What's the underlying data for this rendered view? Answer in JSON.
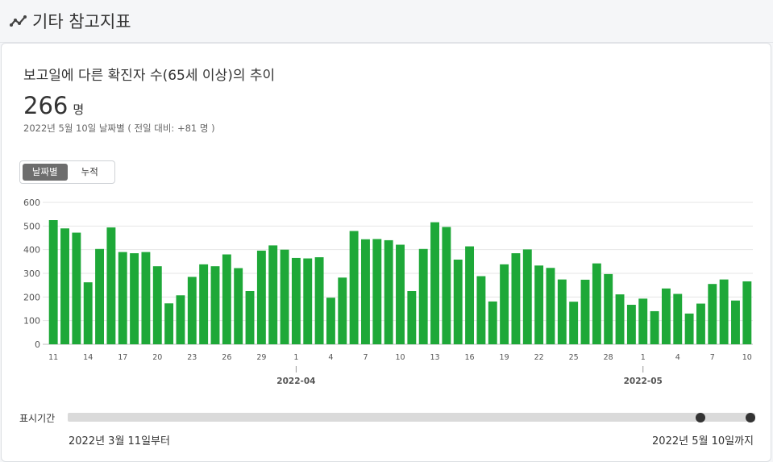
{
  "header": {
    "title": "기타 참고지표",
    "icon": "trend-line-icon"
  },
  "card": {
    "title": "보고일에 다른 확진자 수(65세 이상)의 추이",
    "big_value": "266",
    "big_unit": "명",
    "subtitle": "2022년 5월 10일 날짜별 ( 전일 대비: +81 명 )"
  },
  "toggle": {
    "daily_label": "날짜별",
    "cumulative_label": "누적",
    "selected": "daily"
  },
  "range": {
    "label": "표시기간",
    "start_text": "2022년 3월 11일부터",
    "end_text": "2022년 5월 10일까지"
  },
  "colors": {
    "bar": "#1ea838",
    "grid": "#e6e6e6",
    "handle": "#333333"
  },
  "chart_data": {
    "type": "bar",
    "ylim": [
      0,
      600
    ],
    "yticks": [
      0,
      100,
      200,
      300,
      400,
      500,
      600
    ],
    "xtick_labels": [
      {
        "index": 0,
        "label": "11"
      },
      {
        "index": 3,
        "label": "14"
      },
      {
        "index": 6,
        "label": "17"
      },
      {
        "index": 9,
        "label": "20"
      },
      {
        "index": 12,
        "label": "23"
      },
      {
        "index": 15,
        "label": "26"
      },
      {
        "index": 18,
        "label": "29"
      },
      {
        "index": 21,
        "label": "1"
      },
      {
        "index": 24,
        "label": "4"
      },
      {
        "index": 27,
        "label": "7"
      },
      {
        "index": 30,
        "label": "10"
      },
      {
        "index": 33,
        "label": "13"
      },
      {
        "index": 36,
        "label": "16"
      },
      {
        "index": 39,
        "label": "19"
      },
      {
        "index": 42,
        "label": "22"
      },
      {
        "index": 45,
        "label": "25"
      },
      {
        "index": 48,
        "label": "28"
      },
      {
        "index": 51,
        "label": "1"
      },
      {
        "index": 54,
        "label": "4"
      },
      {
        "index": 57,
        "label": "7"
      },
      {
        "index": 60,
        "label": "10"
      }
    ],
    "month_labels": [
      {
        "index": 21,
        "label": "2022-04"
      },
      {
        "index": 51,
        "label": "2022-05"
      }
    ],
    "values": [
      525,
      490,
      472,
      262,
      403,
      494,
      390,
      385,
      390,
      330,
      173,
      207,
      285,
      338,
      330,
      380,
      322,
      225,
      396,
      418,
      400,
      365,
      363,
      368,
      197,
      282,
      479,
      444,
      445,
      440,
      421,
      225,
      403,
      516,
      496,
      358,
      414,
      288,
      181,
      338,
      385,
      401,
      333,
      323,
      274,
      180,
      273,
      342,
      297,
      211,
      167,
      193,
      140,
      236,
      213,
      130,
      172,
      255,
      274,
      185,
      266
    ]
  }
}
